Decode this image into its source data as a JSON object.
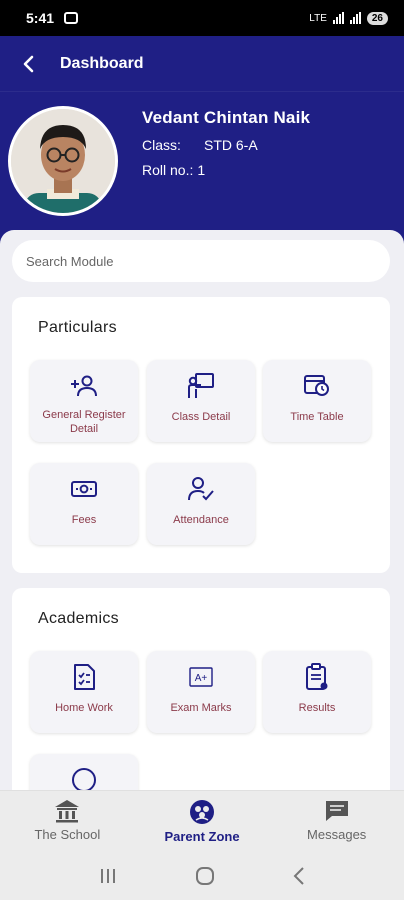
{
  "status_bar": {
    "time": "5:41",
    "network": "LTE",
    "battery": "26"
  },
  "topbar": {
    "title": "Dashboard"
  },
  "profile": {
    "name": "Vedant Chintan Naik",
    "class_label": "Class:",
    "class_value": "STD 6-A",
    "roll_label": "Roll no.:",
    "roll_value": "1"
  },
  "search": {
    "placeholder": "Search Module"
  },
  "particulars": {
    "title": "Particulars",
    "items": [
      {
        "label": "General Register Detail",
        "icon": "add-user-icon"
      },
      {
        "label": "Class Detail",
        "icon": "teacher-board-icon"
      },
      {
        "label": "Time Table",
        "icon": "calendar-clock-icon"
      },
      {
        "label": "Fees",
        "icon": "money-icon"
      },
      {
        "label": "Attendance",
        "icon": "user-check-icon"
      }
    ]
  },
  "academics": {
    "title": "Academics",
    "items": [
      {
        "label": "Home Work",
        "icon": "checklist-icon"
      },
      {
        "label": "Exam Marks",
        "icon": "grade-icon"
      },
      {
        "label": "Results",
        "icon": "clipboard-icon"
      },
      {
        "label": "",
        "icon": "circle-icon"
      }
    ]
  },
  "bottom_nav": {
    "items": [
      {
        "label": "The School",
        "icon": "school-icon"
      },
      {
        "label": "Parent Zone",
        "icon": "parent-zone-icon",
        "active": true
      },
      {
        "label": "Messages",
        "icon": "message-icon"
      }
    ]
  },
  "colors": {
    "primary": "#1f1f85",
    "tile_label": "#8b3a4a",
    "background": "#efeff4"
  }
}
